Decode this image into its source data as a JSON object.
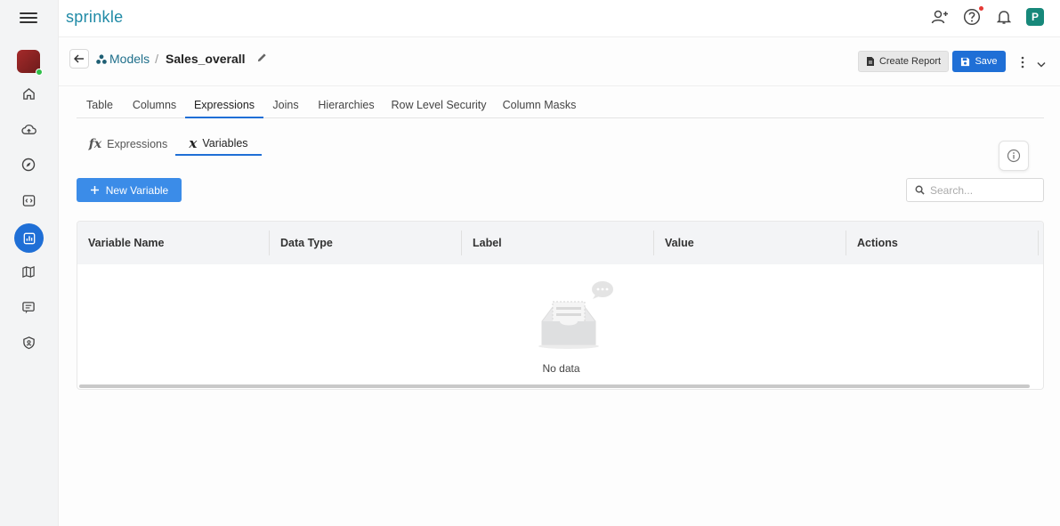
{
  "app": {
    "brand": "sprinkle",
    "avatar_initial": "P",
    "accent": "#1f6fd6"
  },
  "rail": {
    "items": [
      {
        "icon": "home-icon"
      },
      {
        "icon": "cloud-upload-icon"
      },
      {
        "icon": "compass-icon"
      },
      {
        "icon": "code-icon"
      },
      {
        "icon": "report-chart-icon",
        "active": true
      },
      {
        "icon": "map-icon"
      },
      {
        "icon": "comment-list-icon"
      },
      {
        "icon": "shield-icon"
      }
    ]
  },
  "breadcrumb": {
    "parent": "Models",
    "separator": "/",
    "current": "Sales_overall"
  },
  "toolbar": {
    "create_report": "Create Report",
    "save": "Save"
  },
  "tabs": [
    {
      "label": "Table"
    },
    {
      "label": "Columns"
    },
    {
      "label": "Expressions",
      "active": true
    },
    {
      "label": "Joins"
    },
    {
      "label": "Hierarchies"
    },
    {
      "label": "Row Level Security"
    },
    {
      "label": "Column Masks"
    }
  ],
  "subtabs": [
    {
      "label": "Expressions",
      "icon": "fx-icon"
    },
    {
      "label": "Variables",
      "icon": "variable-x-icon",
      "active": true
    }
  ],
  "actions": {
    "new_variable": "New Variable",
    "search_placeholder": "Search..."
  },
  "table": {
    "columns": [
      "Variable Name",
      "Data Type",
      "Label",
      "Value",
      "Actions"
    ],
    "rows": [],
    "empty_text": "No data"
  }
}
